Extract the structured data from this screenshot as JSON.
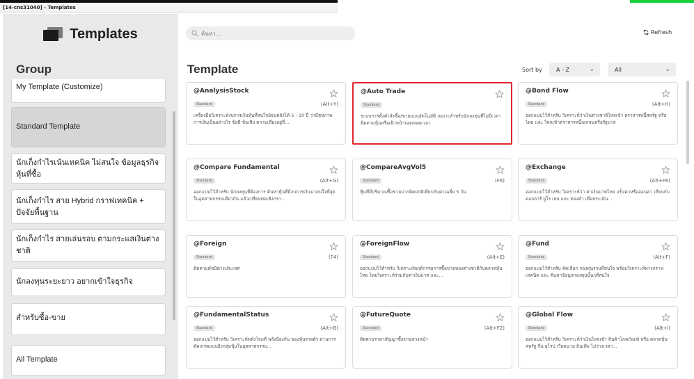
{
  "window": {
    "title": "[14-cns31040] - Templates"
  },
  "sidebar": {
    "logo_text": "Templates",
    "group_heading": "Group",
    "groups": [
      {
        "label": "My Template (Customize)"
      },
      {
        "label": "Standard Template"
      },
      {
        "label": "นักเก็งกำไรเน้นเทคนิค ไม่สนใจ ข้อมูลธุรกิจหุ้นที่ซื้อ"
      },
      {
        "label": "นักเก็งกำไร สาย Hybrid กราฟเทคนิค + ปัจจัยพื้นฐาน"
      },
      {
        "label": "นักเก็งกำไร สายเล่นรอบ ตามกระแสเงินต่างชาติ"
      },
      {
        "label": "นักลงทุนระยะยาว อยากเข้าใจธุรกิจ"
      },
      {
        "label": "สำหรับซื้อ-ขาย"
      },
      {
        "label": "All Template"
      }
    ]
  },
  "toolbar": {
    "search_placeholder": "ค้นหา...",
    "refresh_label": "Refresh"
  },
  "main": {
    "heading": "Template",
    "sort_label": "Sort by",
    "sort_value": "A - Z",
    "filter_value": "All"
  },
  "templates": [
    {
      "name": "@AnalysisStock",
      "badge": "Standard",
      "shortcut": "(Alt+Y)",
      "desc": "เครื่องมือวิเคราะห์งบการเงินหุ้นที่สนใจย้อนหลังได้ 5 - 10 ปี ว่ามีสุขภาพการเงินเป็นอย่างไร ข้อดี ข้อเสีย ความเสี่ยงอยู่ที่..."
    },
    {
      "name": "@Auto Trade",
      "badge": "Standard",
      "shortcut": "",
      "desc": "ระบบการตั้งคำสั่งซื้อ/ขายแบบอัตโนมัติ เหมาะสำหรับนักลงทุนที่ไม่มีเวลาติดตามหุ้นหรือเฝ้าหน้าจอตลอดเวลา"
    },
    {
      "name": "@Bond Flow",
      "badge": "Standard",
      "shortcut": "(Alt+H)",
      "desc": "ออกแบบไว้สำหรับ วิเคราะห์ว่าเงินต่างชาติไหลเข้า ตราสารหนี้สหรัฐ หรือ ไทย และ ไหลเข้าตราสารหนี้เอกชนหรือรัฐบาล"
    },
    {
      "name": "@Compare Fundamental",
      "badge": "Standard",
      "shortcut": "(Alt+G)",
      "desc": "ออกแบบไว้สำหรับ นักลงทุนที่ต้องการ ค้นหาหุ้นที่มีงบการเงินน่าสนใจที่สุดในอุตสาหกรรมเดียวกัน แล้วเปรียบต่อเชิงกรา..."
    },
    {
      "name": "@CompareAvgVol5",
      "badge": "Standard",
      "shortcut": "(F6)",
      "desc": "หุ้นที่มีปริมาณซื้อขายมากผิดปกติเทียบกับค่าเฉลี่ย 5 วัน"
    },
    {
      "name": "@Exchange",
      "badge": "Standard",
      "shortcut": "(Alt+F6)",
      "desc": "ออกแบบไว้สำหรับ วิเคราะห์ว่า ค่าเงินบาทไทย แข็งค่าหรืออ่อนค่า เทียบกับ ดอลลาร์ ยูโร เยน และ ทองคำ เพื่อประเมิน..."
    },
    {
      "name": "@Foreign",
      "badge": "Standard",
      "shortcut": "(F4)",
      "desc": "ติดตามดัชนีต่างประเทศ"
    },
    {
      "name": "@ForeignFlow",
      "badge": "Standard",
      "shortcut": "(Alt+E)",
      "desc": "ออกแบบไว้สำหรับ วิเคราะห์พฤติกรรมการซื้อขายของต่างชาติกับตลาดหุ้นไทย โดยวิเคราะห์ร่วมกับค่าเงินบาท และ..."
    },
    {
      "name": "@Fund",
      "badge": "Standard",
      "shortcut": "(Alt+F)",
      "desc": "ออกแบบไว้สำหรับ คัดเลือก กองทุนรวมที่สนใจ พร้อมวิเคราะห์ทางกราฟเทคนิค และ ค้นหาข้อมูลกองทุนนั้นๆที่สนใจ"
    },
    {
      "name": "@FundamentalStatus",
      "badge": "Standard",
      "shortcut": "(Alt+B)",
      "desc": "ออกแบบไว้สำหรับ วิเคราะห์พลังโจมตี พลังป้องกัน ของหุ้นรายตัว ผ่านการตัดเกรดแบบอิงกลุ่มหุ้นในอุตสาหกรรม..."
    },
    {
      "name": "@FutureQuote",
      "badge": "Standard",
      "shortcut": "(Alt+F2)",
      "desc": "ติดตามราคาสัญญาซื้อขายล่วงหน้า"
    },
    {
      "name": "@Global Flow",
      "badge": "Standard",
      "shortcut": "(Alt+I)",
      "desc": "ออกแบบไว้สำหรับ วิเคราะห์ว่าเงินไหลเข้า สินค้าโภคภัณฑ์ หรือ ตลาดหุ้นสหรัฐ จีน ยุโรป เวียดนาม อินเดีย ไม่ว่างเวลา..."
    }
  ]
}
